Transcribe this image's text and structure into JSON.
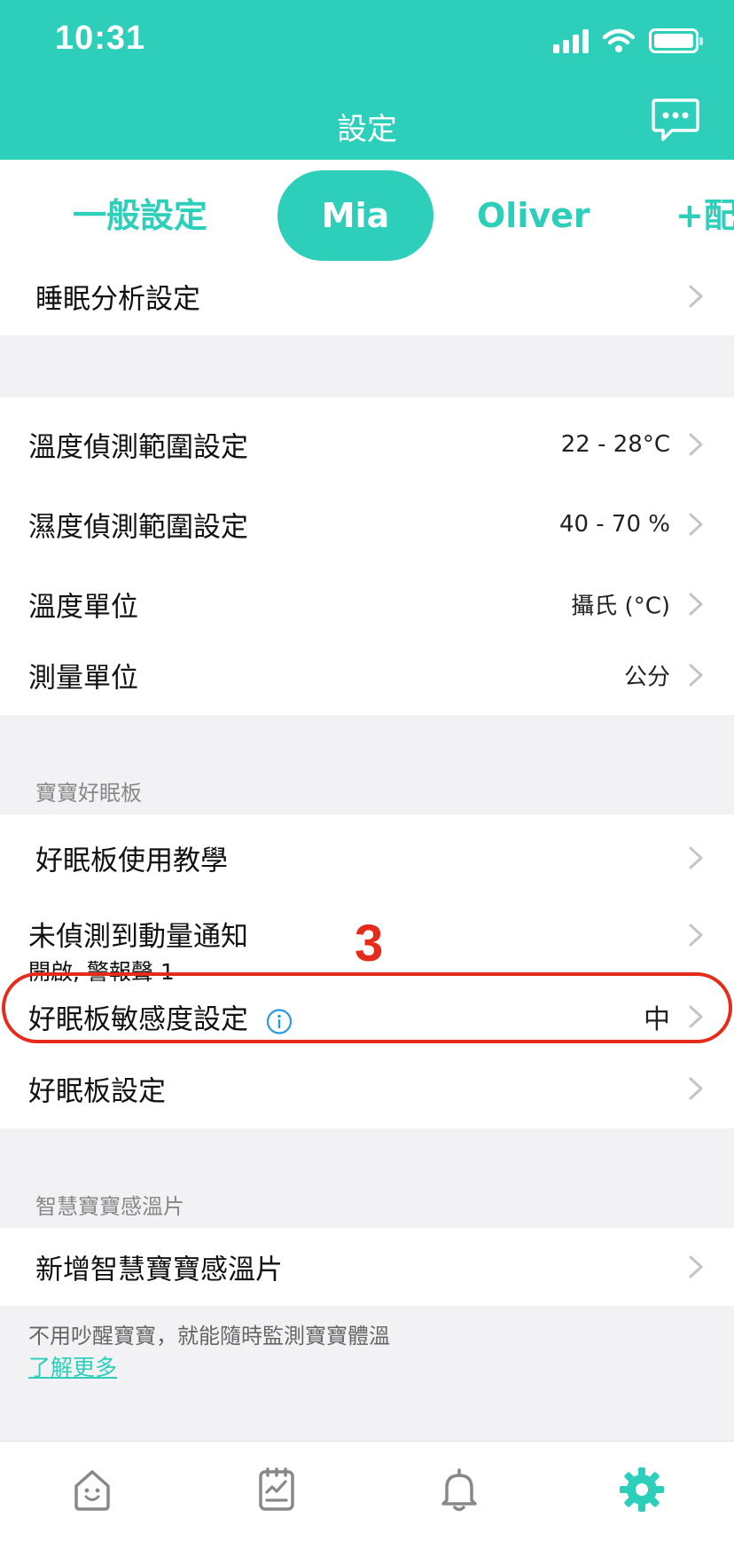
{
  "status_bar": {
    "time": "10:31"
  },
  "header": {
    "title": "設定"
  },
  "tabs": [
    {
      "label": "一般設定",
      "active": false
    },
    {
      "label": "Mia",
      "active": true
    },
    {
      "label": "Oliver",
      "active": false
    },
    {
      "label": "+配對",
      "active": false
    }
  ],
  "sleep_section": {
    "label": "睡眠分析設定"
  },
  "range_section": {
    "rows": [
      {
        "label": "溫度偵測範圍設定",
        "value": "22 - 28°C"
      },
      {
        "label": "濕度偵測範圍設定",
        "value": "40 - 70 %"
      },
      {
        "label": "溫度單位",
        "value": "攝氏 (°C)"
      },
      {
        "label": "測量單位",
        "value": "公分"
      }
    ]
  },
  "board_section": {
    "header": "寶寶好眠板",
    "tutorial_label": "好眠板使用教學",
    "no_motion": {
      "label": "未偵測到動量通知",
      "sublabel": "開啟, 警報聲 1"
    },
    "sensitivity": {
      "label": "好眠板敏感度設定",
      "value": "中"
    },
    "settings_label": "好眠板設定"
  },
  "annotation": {
    "number": "3",
    "color": "#e52b1a"
  },
  "thermo_section": {
    "header": "智慧寶寶感溫片",
    "add_label": "新增智慧寶寶感溫片",
    "description": "不用吵醒寶寶，就能隨時監測寶寶體溫",
    "learn_more": "了解更多"
  },
  "bottom_nav": [
    {
      "icon": "home-icon",
      "active": false
    },
    {
      "icon": "report-icon",
      "active": false
    },
    {
      "icon": "bell-icon",
      "active": false
    },
    {
      "icon": "gear-icon",
      "active": true
    }
  ],
  "colors": {
    "accent": "#2dcfbb",
    "highlight": "#e52b1a",
    "background": "#f2f2f4"
  }
}
